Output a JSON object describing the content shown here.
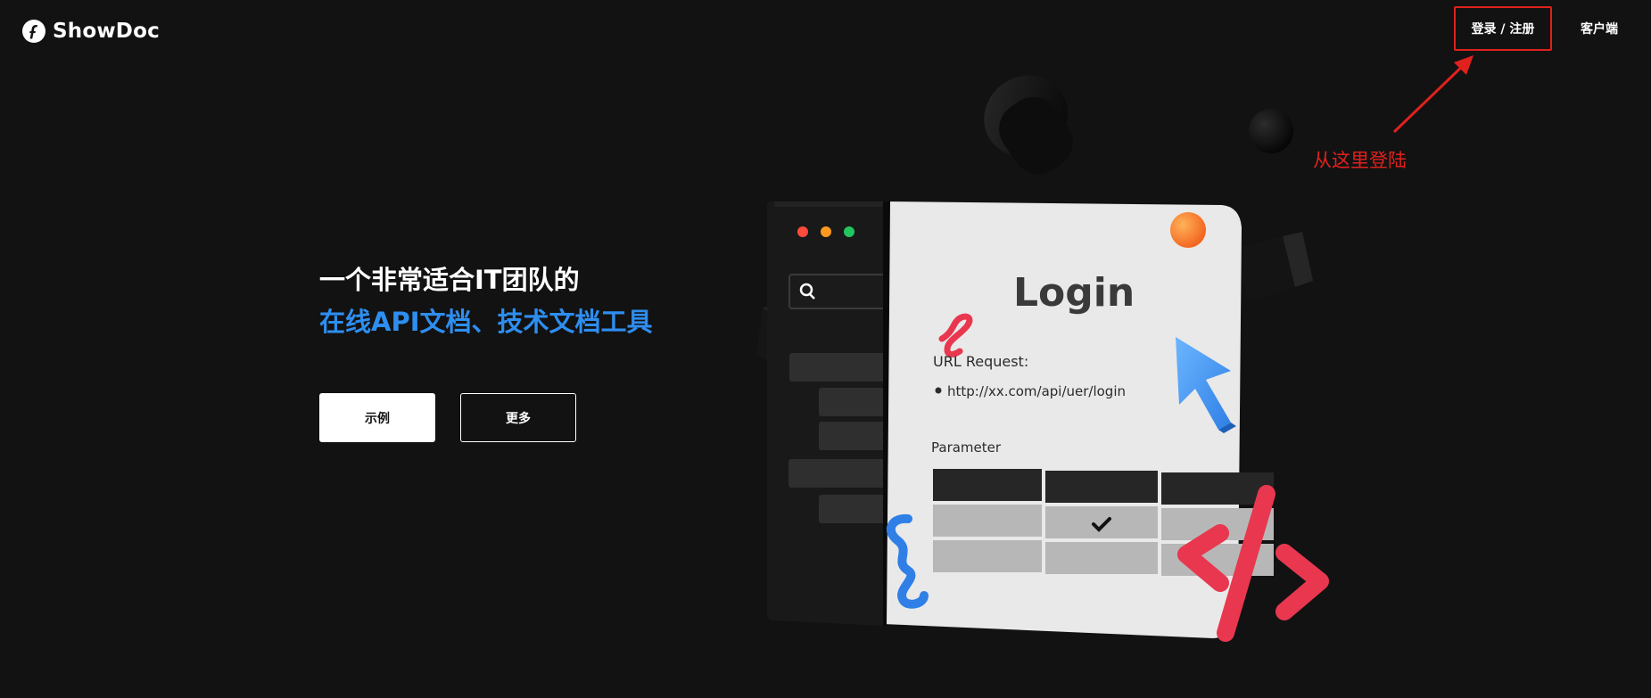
{
  "header": {
    "logo_text": "ShowDoc",
    "login_label": "登录 / 注册",
    "client_label": "客户端"
  },
  "annotation": {
    "text": "从这里登陆",
    "color": "#e0211d"
  },
  "hero": {
    "title_line1": "一个非常适合IT团队的",
    "title_line2": "在线API文档、技术文档工具",
    "accent_color": "#2e8ef0",
    "buttons": {
      "demo_label": "示例",
      "more_label": "更多"
    }
  },
  "illustration": {
    "window_title": "Login",
    "url_label": "URL Request:",
    "url_value": "http://xx.com/api/uer/login",
    "param_label": "Parameter",
    "window_dots": [
      "#ff4b3e",
      "#ff9a1f",
      "#22c55e"
    ]
  }
}
